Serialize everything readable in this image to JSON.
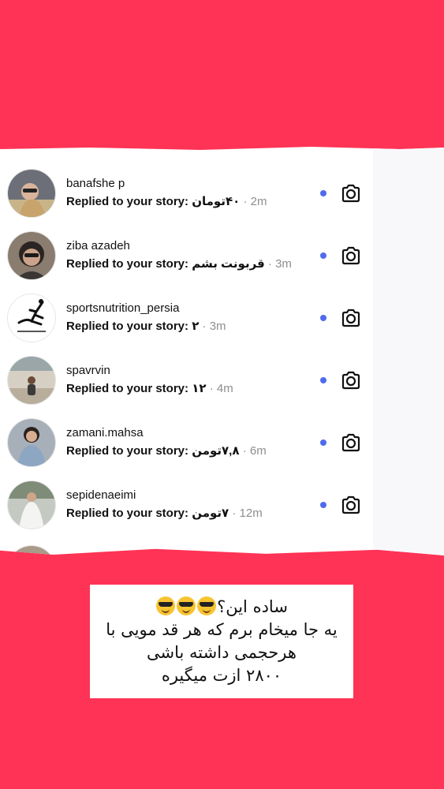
{
  "colors": {
    "background": "#ff3356",
    "unread_dot": "#4f6bed",
    "time": "#8e8e8e"
  },
  "notifications": [
    {
      "username": "banafshe p",
      "prefix": "Replied to your story:",
      "reply": "۴۰تومان",
      "time": "· 2m",
      "avatar": "avatar-photo",
      "icon": "camera-icon"
    },
    {
      "username": "ziba azadeh",
      "prefix": "Replied to your story:",
      "reply": "قربونت بشم",
      "time": "· 3m",
      "avatar": "avatar-photo",
      "icon": "camera-icon"
    },
    {
      "username": "sportsnutrition_persia",
      "prefix": "Replied to your story:",
      "reply": "۲",
      "time": "· 3m",
      "avatar": "avatar-logo",
      "icon": "camera-icon"
    },
    {
      "username": "spavrvin",
      "prefix": "Replied to your story:",
      "reply": "۱۲",
      "time": "· 4m",
      "avatar": "avatar-photo",
      "icon": "camera-icon"
    },
    {
      "username": "zamani.mahsa",
      "prefix": "Replied to your story:",
      "reply": "۷,۸تومن",
      "time": "· 6m",
      "avatar": "avatar-photo",
      "icon": "camera-icon"
    },
    {
      "username": "sepidenaeimi",
      "prefix": "Replied to your story:",
      "reply": "۷تومن",
      "time": "· 12m",
      "avatar": "avatar-photo",
      "icon": "camera-icon"
    }
  ],
  "caption": {
    "line1": "ساده این؟",
    "line2": "یه جا میخام برم که هر قد مویی با",
    "line3": "هرحجمی داشته باشی",
    "line4": "۲۸۰۰ ازت میگیره"
  }
}
